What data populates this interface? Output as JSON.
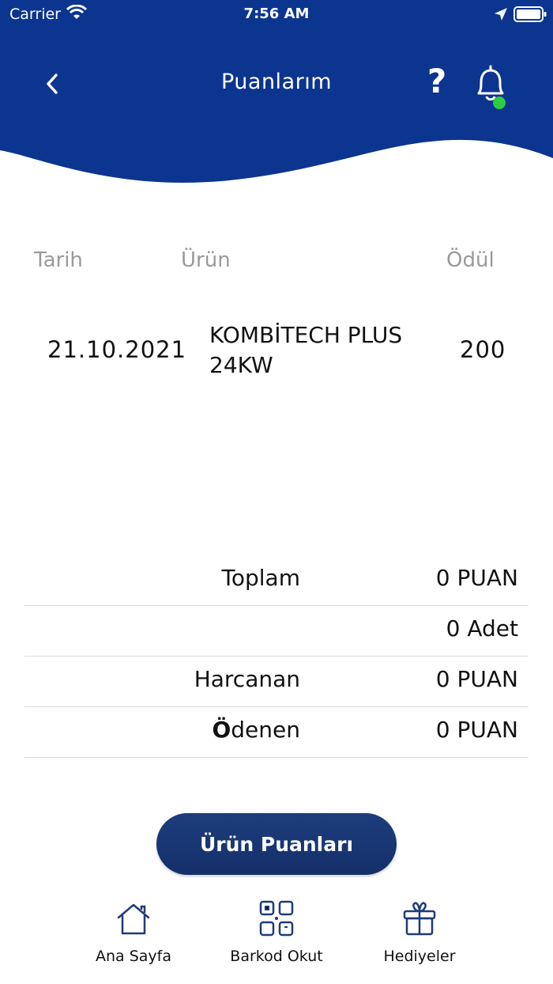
{
  "status_bar": {
    "carrier": "Carrier",
    "time": "7:56 AM"
  },
  "header": {
    "title": "Puanlarım",
    "help_label": "?",
    "background_color": "#0c3590",
    "notification_dot_color": "#2ecc40"
  },
  "table": {
    "headers": {
      "date": "Tarih",
      "product": "Ürün",
      "reward": "Ödül"
    },
    "rows": [
      {
        "date": "21.10.2021",
        "product": "KOMBİTECH PLUS 24KW",
        "reward": "200"
      }
    ]
  },
  "summary": [
    {
      "label": "Toplam",
      "value": "0 PUAN"
    },
    {
      "label": "",
      "value": "0 Adet"
    },
    {
      "label": "Harcanan",
      "value": "0 PUAN"
    },
    {
      "label_first": "Ö",
      "label_rest": "denen",
      "value": "0 PUAN"
    }
  ],
  "action_button": {
    "label": "Ürün Puanları"
  },
  "tabbar": {
    "items": [
      {
        "label": "Ana Sayfa",
        "icon": "home-icon"
      },
      {
        "label": "Barkod Okut",
        "icon": "qr-code-icon"
      },
      {
        "label": "Hediyeler",
        "icon": "gift-icon"
      }
    ]
  }
}
